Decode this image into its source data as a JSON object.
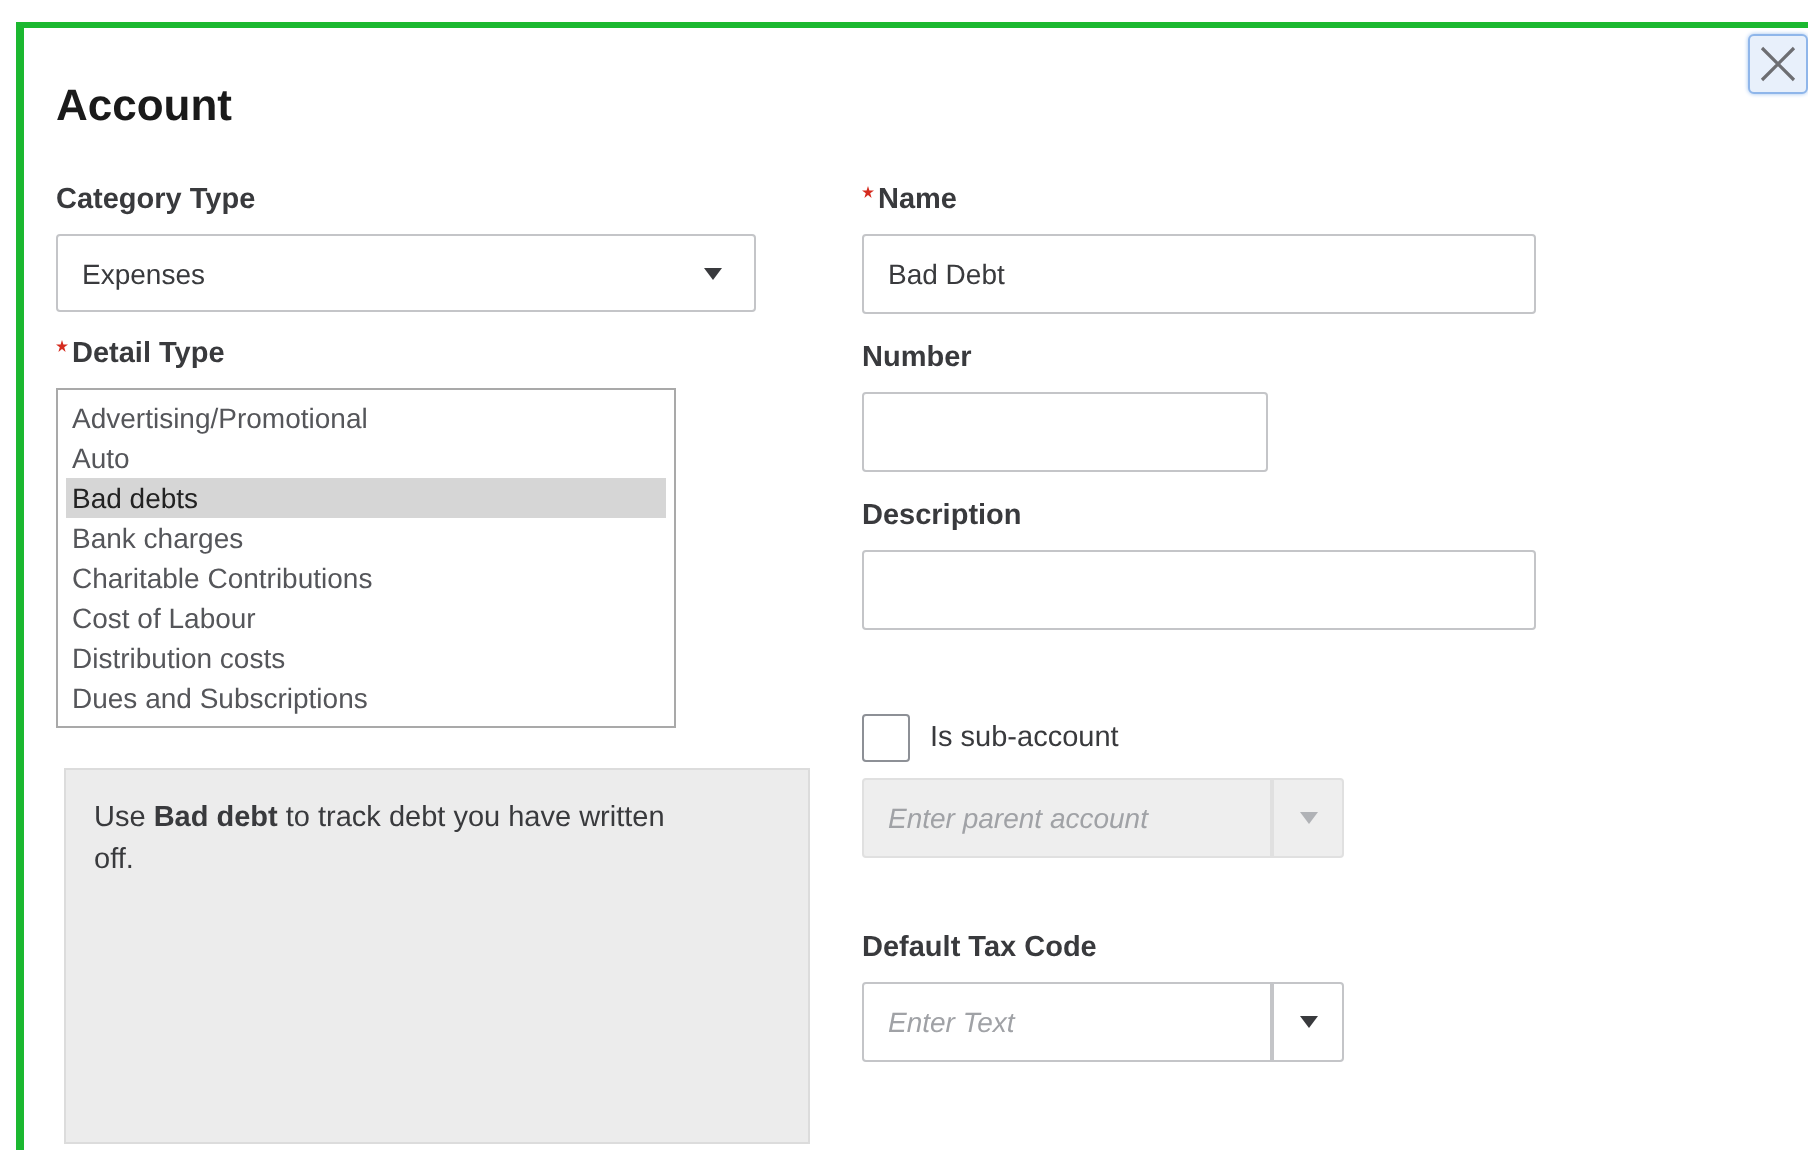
{
  "window": {
    "title": "Account"
  },
  "category_type": {
    "label": "Category Type",
    "value": "Expenses"
  },
  "detail_type": {
    "label": "Detail Type",
    "required": true,
    "items": [
      {
        "label": "Advertising/Promotional",
        "selected": false
      },
      {
        "label": "Auto",
        "selected": false
      },
      {
        "label": "Bad debts",
        "selected": true
      },
      {
        "label": "Bank charges",
        "selected": false
      },
      {
        "label": "Charitable Contributions",
        "selected": false
      },
      {
        "label": "Cost of Labour",
        "selected": false
      },
      {
        "label": "Distribution costs",
        "selected": false
      },
      {
        "label": "Dues and Subscriptions",
        "selected": false
      }
    ]
  },
  "help": {
    "text": "Use **Bad debt** to track debt you have written off."
  },
  "name": {
    "label": "Name",
    "required": true,
    "value": "Bad Debt"
  },
  "number": {
    "label": "Number",
    "required": false
  },
  "description": {
    "label": "Description",
    "required": false
  },
  "sub_account": {
    "label": "Is sub-account",
    "checked": false
  },
  "parent_account": {
    "placeholder": "Enter parent account",
    "disabled": true
  },
  "default_tax_code": {
    "label": "Default Tax Code",
    "placeholder": "Enter Text"
  }
}
